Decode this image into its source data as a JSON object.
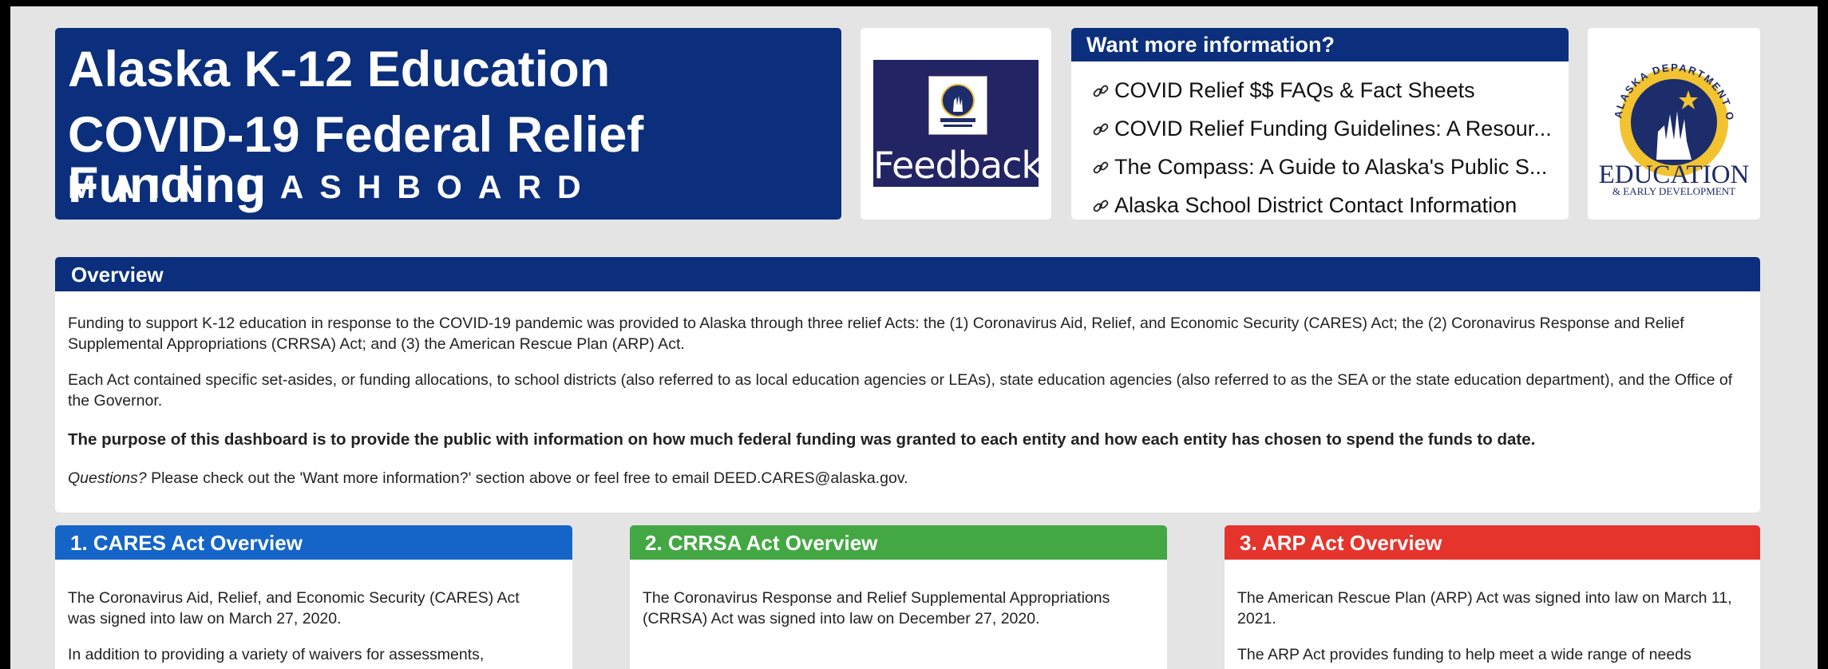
{
  "header": {
    "title_line1": "Alaska K-12 Education",
    "title_line2": "COVID-19 Federal Relief Funding",
    "title_line3": "MAIN DASHBOARD"
  },
  "feedback": {
    "label": "Feedback"
  },
  "info": {
    "title": "Want more information?",
    "links": [
      "COVID Relief $$ FAQs & Fact Sheets",
      "COVID Relief Funding Guidelines: A Resour...",
      "The Compass: A Guide to Alaska's Public S...",
      "Alaska School District Contact Information"
    ]
  },
  "logo": {
    "arc_text": "ALASKA DEPARTMENT OF",
    "main_text": "EDUCATION",
    "sub_text": "& EARLY DEVELOPMENT"
  },
  "overview": {
    "title": "Overview",
    "para1": "Funding to support K-12 education in response to the COVID-19 pandemic was provided to Alaska through three relief Acts: the (1) Coronavirus Aid, Relief, and Economic Security (CARES) Act; the (2) Coronavirus Response and Relief Supplemental Appropriations (CRRSA) Act; and (3) the American Rescue Plan (ARP) Act.",
    "para2": "Each Act contained specific set-asides, or funding allocations, to school districts (also referred to as local education agencies or LEAs), state education agencies (also referred to as the SEA or the state education department), and the Office of the Governor.",
    "para3": "The purpose of this dashboard is to provide the public with information on how much federal funding was granted to each entity and how each entity has chosen to spend the funds to date.",
    "para4_em": "Questions?",
    "para4_rest": " Please check out the 'Want more information?' section above or feel free to email DEED.CARES@alaska.gov."
  },
  "acts": [
    {
      "title": "1. CARES Act Overview",
      "color": "#1565c8",
      "para1": "The Coronavirus Aid, Relief, and Economic Security (CARES) Act was signed into law on March 27, 2020.",
      "para2": "In addition to providing a variety of waivers for assessments,"
    },
    {
      "title": "2. CRRSA Act Overview",
      "color": "#43a843",
      "para1": "The Coronavirus Response and Relief Supplemental Appropriations (CRRSA) Act was signed into law on December 27, 2020."
    },
    {
      "title": "3. ARP Act Overview",
      "color": "#e5342c",
      "para1": "The American Rescue Plan (ARP) Act was signed into law on March 11, 2021.",
      "para2": "The ARP Act provides funding to help meet a wide range of needs"
    }
  ]
}
